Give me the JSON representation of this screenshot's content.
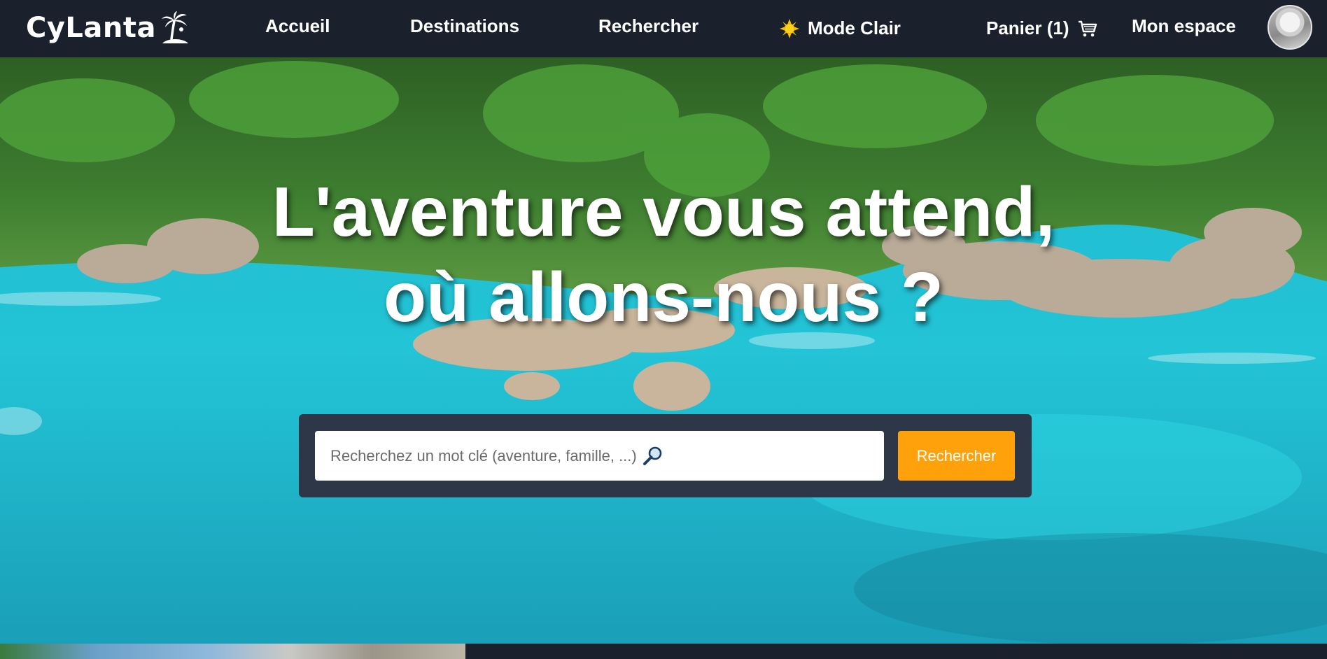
{
  "nav": {
    "logo_text": "CyLanta",
    "logo_icon": "palm-island-icon",
    "links": {
      "accueil": "Accueil",
      "destinations": "Destinations",
      "rechercher": "Rechercher",
      "mode": "Mode Clair",
      "panier": "Panier (1)",
      "espace": "Mon espace"
    },
    "mode_icon": "sun-icon",
    "cart_icon": "cart-icon"
  },
  "hero": {
    "title_line1": "L'aventure vous attend,",
    "title_line2": "où allons-nous ?"
  },
  "search": {
    "placeholder": "Recherchez un mot clé (aventure, famille, ...)",
    "button_label": "Rechercher",
    "icon": "magnifier-icon",
    "button_color": "#ffa10a"
  },
  "colors": {
    "navbar_bg": "#1b202d",
    "panel_bg": "#2e3748"
  }
}
